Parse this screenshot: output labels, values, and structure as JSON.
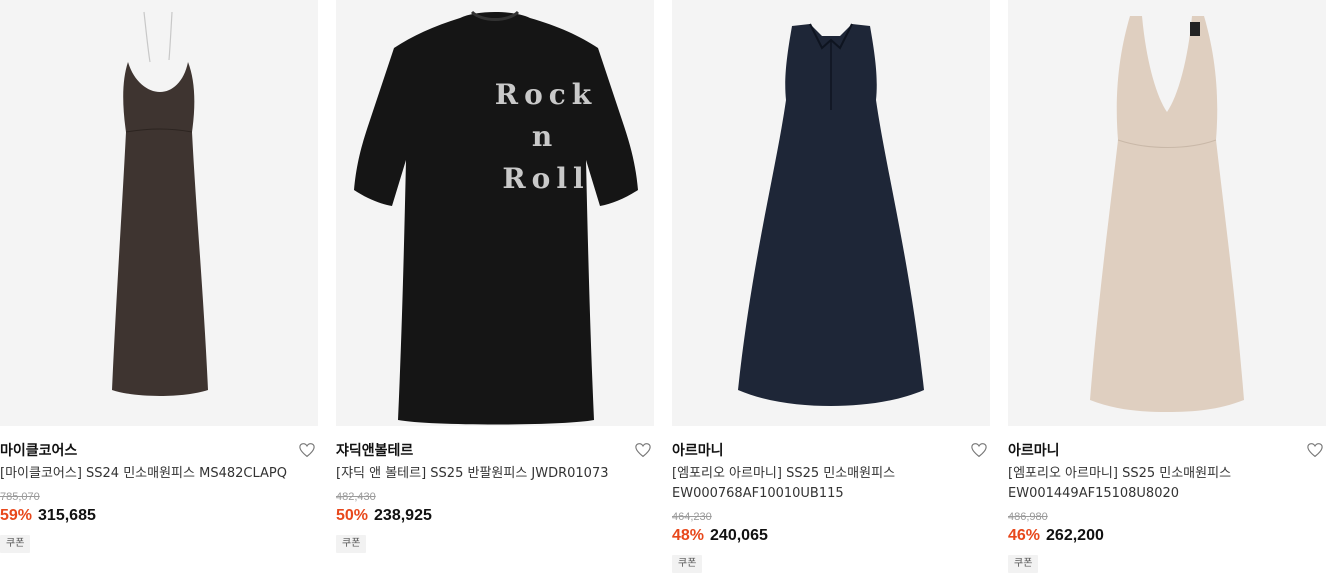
{
  "products": [
    {
      "brand": "마이클코어스",
      "name_lines": [
        "[마이클코어스] SS24 민소매원피스 MS482CLAPQ"
      ],
      "original_price": "785,070",
      "discount": "59%",
      "price": "315,685",
      "coupon": "쿠폰",
      "image": "brown-halter-maxi-dress",
      "dress_color": "#3e3430"
    },
    {
      "brand": "쟈딕앤볼테르",
      "name_lines": [
        "[쟈딕 앤 볼테르] SS25 반팔원피스 JWDR01073"
      ],
      "original_price": "482,430",
      "discount": "50%",
      "price": "238,925",
      "coupon": "쿠폰",
      "image": "black-rock-n-roll-tshirt-dress",
      "dress_color": "#151515",
      "print_text": [
        "Rock",
        "n",
        "Roll"
      ]
    },
    {
      "brand": "아르마니",
      "name_lines": [
        "[엠포리오 아르마니] SS25 민소매원피스",
        "EW000768AF10010UB115"
      ],
      "original_price": "464,230",
      "discount": "48%",
      "price": "240,065",
      "coupon": "쿠폰",
      "image": "navy-sleeveless-collared-dress",
      "dress_color": "#1e2637"
    },
    {
      "brand": "아르마니",
      "name_lines": [
        "[엠포리오 아르마니] SS25 민소매원피스",
        "EW001449AF15108U8020"
      ],
      "original_price": "486,980",
      "discount": "46%",
      "price": "262,200",
      "coupon": "쿠폰",
      "image": "beige-knit-sleeveless-dress",
      "dress_color": "#dfcfc0"
    }
  ],
  "colors": {
    "discount": "#e8481c",
    "thumb_background": "#f4f4f4"
  }
}
